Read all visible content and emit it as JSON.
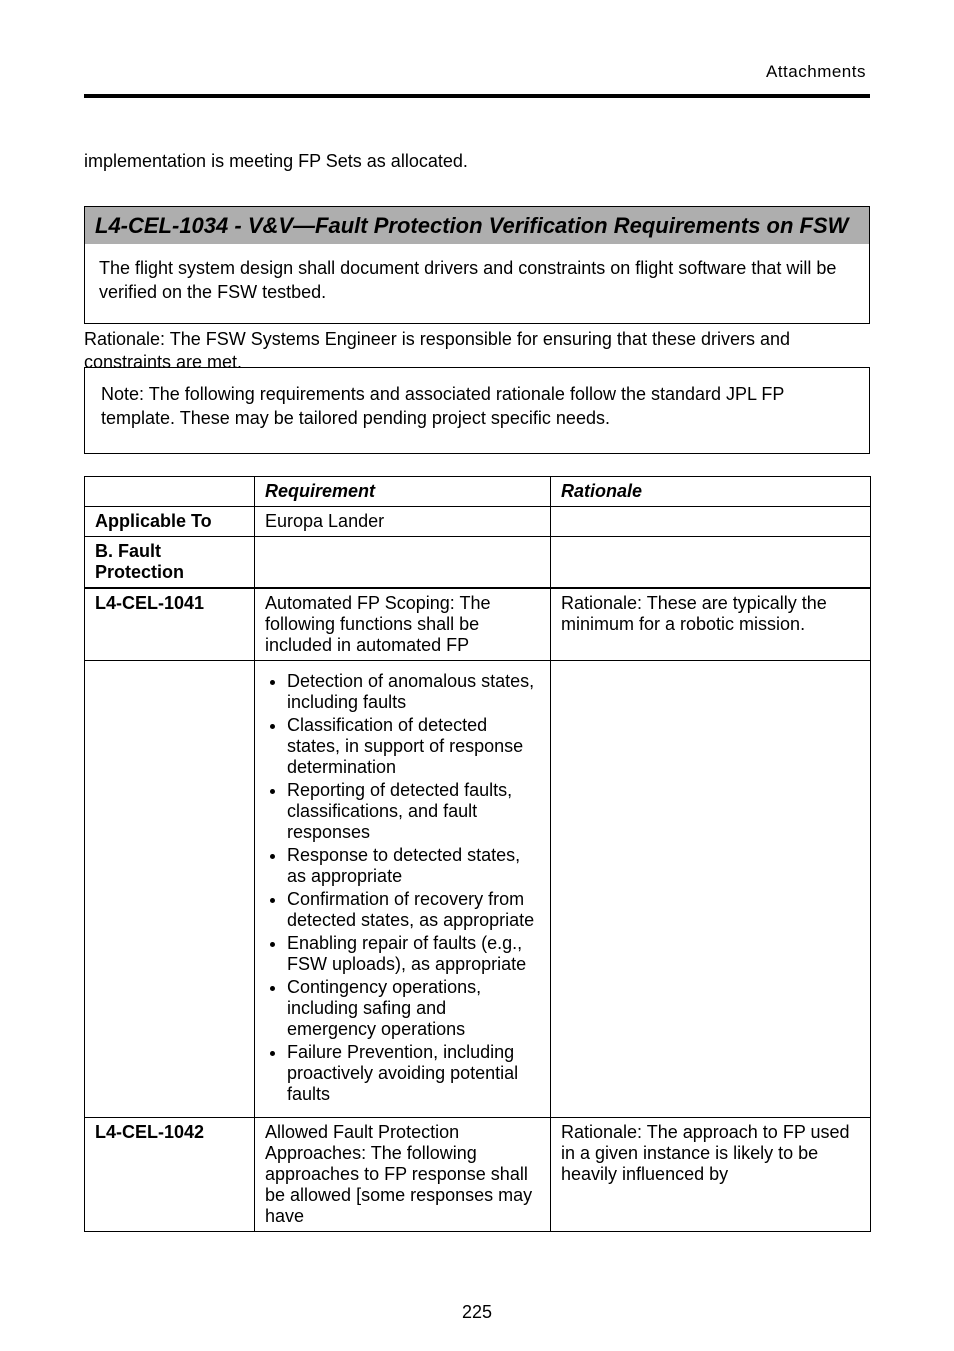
{
  "header_label": "Attachments",
  "intro": "implementation is meeting FP Sets as allocated.",
  "banner_title": "L4-CEL-1034 - V&V—Fault Protection Verification Requirements on FSW",
  "banner_body": "The flight system design shall document drivers and constraints on flight software that will be verified on the FSW testbed.",
  "afterbanner": "Rationale: The FSW Systems Engineer is responsible for ensuring that these drivers and constraints are met.",
  "note": "Note: The following requirements and associated rationale follow the standard JPL FP template. These may be tailored pending project specific needs.",
  "tab": {
    "headers": [
      "",
      "Requirement",
      "Rationale"
    ],
    "rows": [
      {
        "label": "Applicable To",
        "left": "Europa Lander",
        "right": ""
      },
      {
        "label": "B. Fault Protection",
        "left": "",
        "right": "",
        "thick": true
      },
      {
        "label": "L4-CEL-1041",
        "left": "Automated FP Scoping: The following functions shall be included in automated FP",
        "right": "Rationale: These are typically the minimum for a robotic mission."
      },
      {
        "label": "",
        "left_list": [
          "Detection of anomalous states, including faults",
          "Classification of detected states, in support of response determination",
          "Reporting of detected faults, classifications, and fault responses",
          "Response to detected states, as appropriate",
          "Confirmation of recovery from detected states, as appropriate",
          "Enabling repair of faults (e.g., FSW uploads), as appropriate",
          "Contingency operations, including safing and emergency operations",
          "Failure Prevention, including proactively avoiding potential faults"
        ],
        "right": ""
      },
      {
        "label": "L4-CEL-1042",
        "left": "Allowed Fault Protection Approaches: The following approaches to FP response shall be allowed [some responses may have",
        "right": "Rationale: The approach to FP used in a given instance is likely to be heavily influenced by"
      }
    ]
  },
  "page_number": "225"
}
